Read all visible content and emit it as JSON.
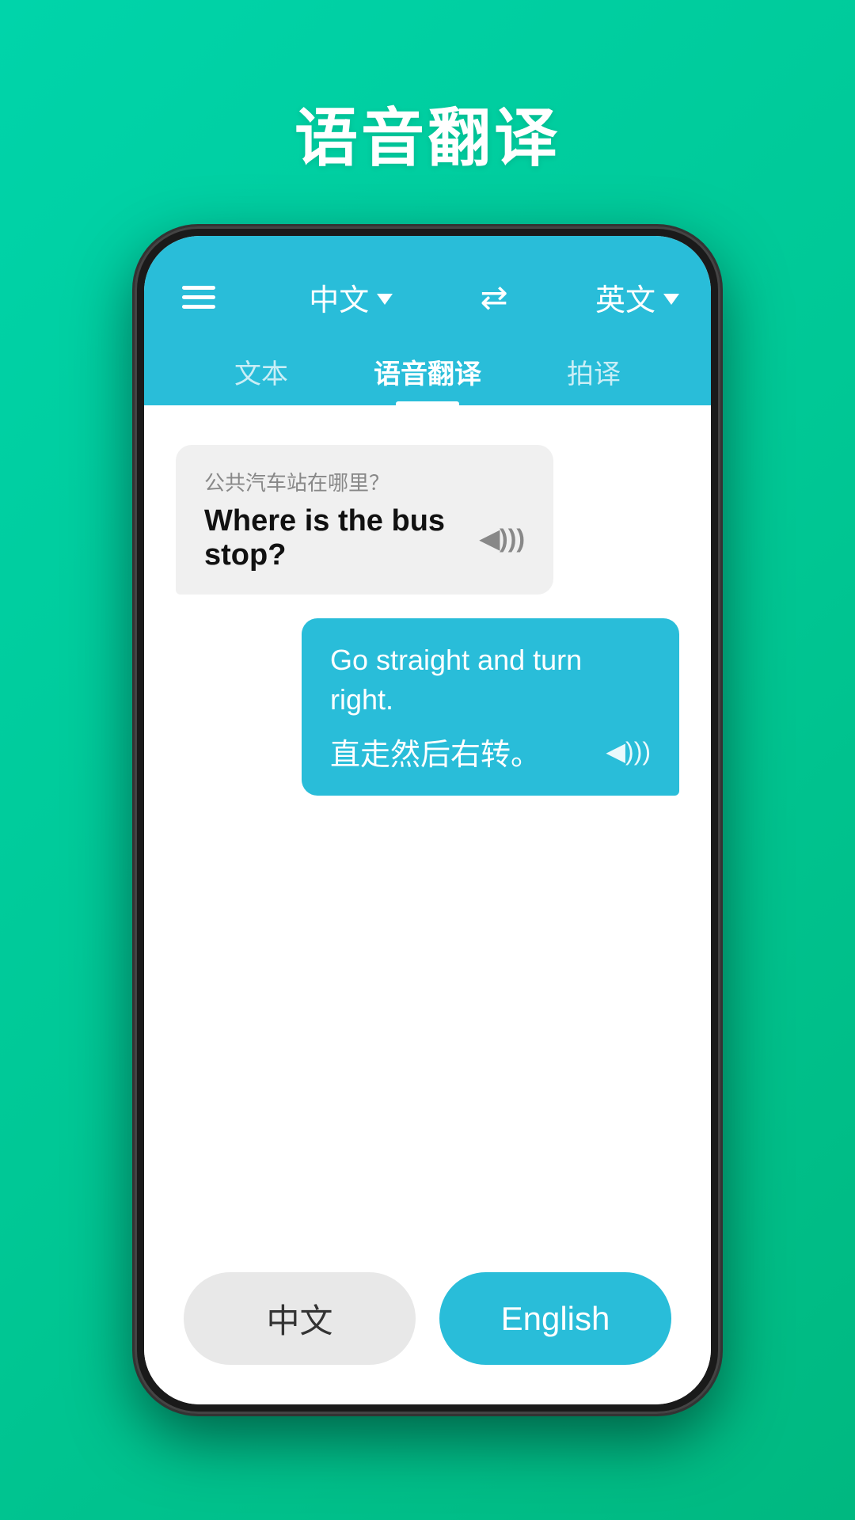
{
  "page": {
    "title": "语音翻译",
    "background_color": "#00c896"
  },
  "header": {
    "menu_label": "menu",
    "source_lang": "中文",
    "target_lang": "英文",
    "swap_symbol": "⇄"
  },
  "tabs": [
    {
      "id": "text",
      "label": "文本",
      "active": false
    },
    {
      "id": "voice",
      "label": "语音翻译",
      "active": true
    },
    {
      "id": "photo",
      "label": "拍译",
      "active": false
    }
  ],
  "messages": [
    {
      "id": "msg1",
      "direction": "left",
      "sub_text": "公共汽车站在哪里？",
      "main_text": "Where is the bus stop?",
      "sound_symbol": "◀)))"
    },
    {
      "id": "msg2",
      "direction": "right",
      "main_text": "Go straight and turn right.",
      "sub_text": "直走然后右转。",
      "sound_symbol": "◀)))"
    }
  ],
  "bottom_buttons": {
    "chinese": "中文",
    "english": "English"
  }
}
